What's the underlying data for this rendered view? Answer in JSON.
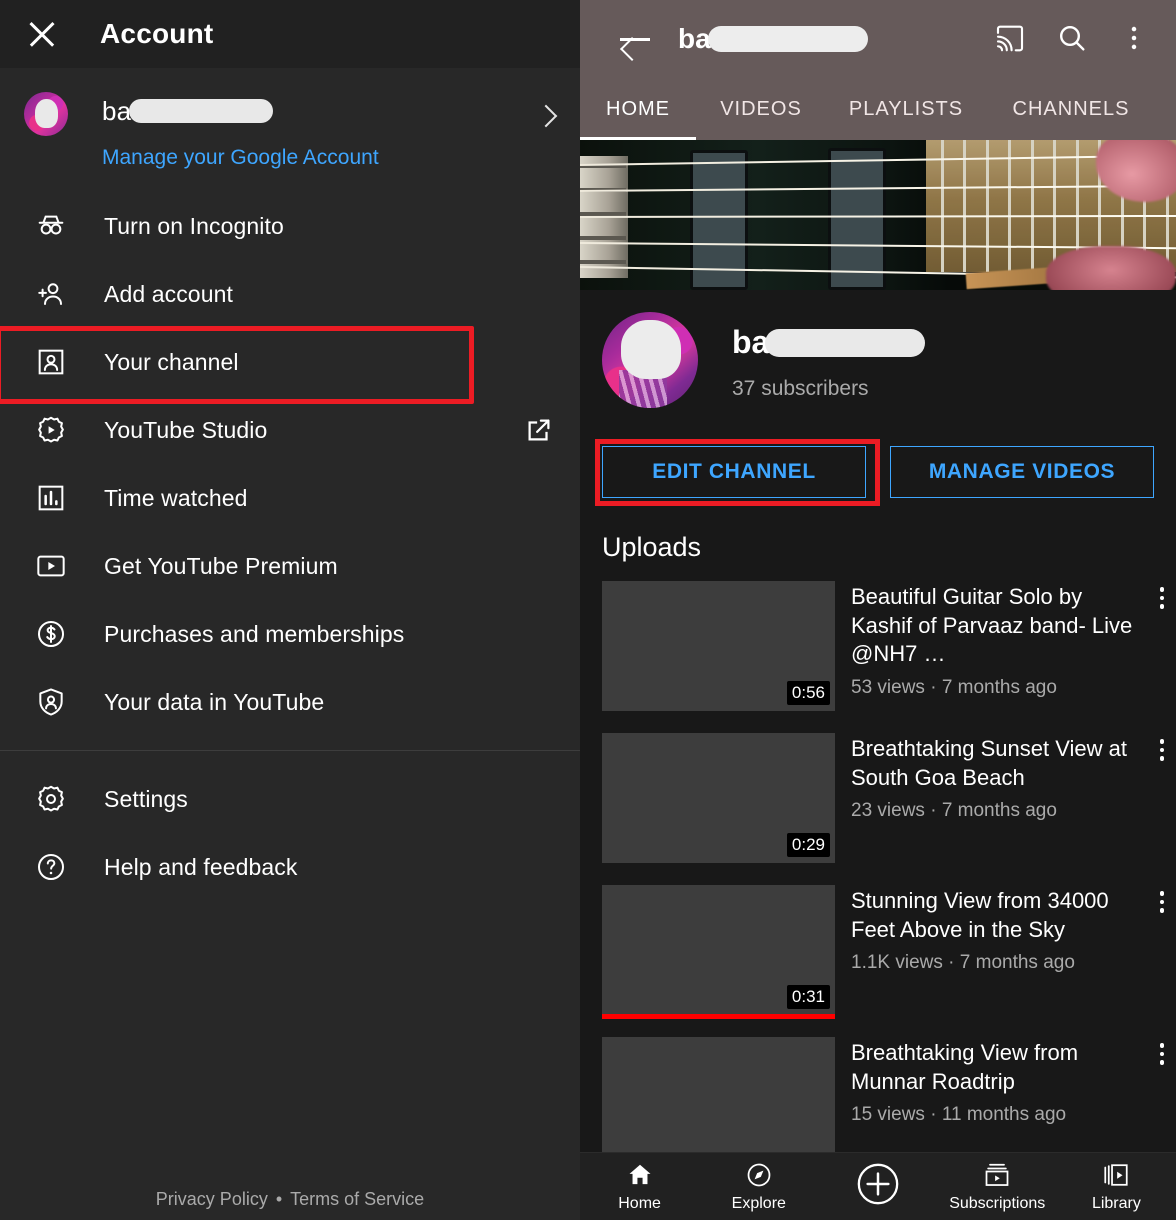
{
  "left_panel": {
    "header": {
      "title": "Account",
      "close_icon": "close-icon"
    },
    "account": {
      "name_prefix": "ba",
      "name_redacted": true,
      "manage_link": "Manage your Google Account",
      "chevron_icon": "chevron-right-icon",
      "avatar_icon": "avatar"
    },
    "menu_group_1": [
      {
        "label": "Turn on Incognito",
        "icon": "incognito-icon"
      },
      {
        "label": "Add account",
        "icon": "person-add-icon"
      },
      {
        "label": "Your channel",
        "icon": "person-box-icon",
        "highlighted": true
      },
      {
        "label": "YouTube Studio",
        "icon": "studio-gear-icon",
        "trailing_icon": "open-in-new-icon"
      },
      {
        "label": "Time watched",
        "icon": "bar-chart-icon"
      },
      {
        "label": "Get YouTube Premium",
        "icon": "youtube-play-icon"
      },
      {
        "label": "Purchases and memberships",
        "icon": "dollar-circle-icon"
      },
      {
        "label": "Your data in YouTube",
        "icon": "shield-person-icon"
      }
    ],
    "menu_group_2": [
      {
        "label": "Settings",
        "icon": "gear-icon"
      },
      {
        "label": "Help and feedback",
        "icon": "help-circle-icon"
      }
    ],
    "footer": {
      "privacy": "Privacy Policy",
      "separator": "•",
      "terms": "Terms of Service"
    }
  },
  "right_panel": {
    "header": {
      "back_icon": "back-arrow-icon",
      "title_prefix": "ba",
      "title_redacted": true,
      "actions": [
        {
          "icon": "cast-icon"
        },
        {
          "icon": "search-icon"
        },
        {
          "icon": "more-vert-icon"
        }
      ]
    },
    "tabs": [
      {
        "label": "HOME",
        "active": true
      },
      {
        "label": "VIDEOS",
        "active": false
      },
      {
        "label": "PLAYLISTS",
        "active": false
      },
      {
        "label": "CHANNELS",
        "active": false
      }
    ],
    "banner": {
      "icon": "channel-banner-bass-guitar"
    },
    "channel": {
      "avatar_icon": "channel-avatar",
      "name_prefix": "ba",
      "name_redacted": true,
      "subscribers": "37 subscribers"
    },
    "buttons": [
      {
        "label": "EDIT CHANNEL",
        "highlighted": true
      },
      {
        "label": "MANAGE VIDEOS",
        "highlighted": false
      }
    ],
    "uploads": {
      "section_title": "Uploads",
      "videos": [
        {
          "title": "Beautiful Guitar Solo by Kashif of Parvaaz band- Live @NH7 …",
          "views": "53 views",
          "separator": "·",
          "age": "7 months ago",
          "duration": "0:56",
          "progress": false
        },
        {
          "title": "Breathtaking Sunset View at South Goa Beach",
          "views": "23 views",
          "separator": "·",
          "age": "7 months ago",
          "duration": "0:29",
          "progress": false
        },
        {
          "title": "Stunning View from 34000 Feet Above in the Sky",
          "views": "1.1K views",
          "separator": "·",
          "age": "7 months ago",
          "duration": "0:31",
          "progress": true
        },
        {
          "title": "Breathtaking View from Munnar Roadtrip",
          "views": "15 views",
          "separator": "·",
          "age": "11 months ago",
          "duration": "",
          "progress": false
        }
      ]
    },
    "bottom_nav": [
      {
        "label": "Home",
        "icon": "home-icon",
        "active": true
      },
      {
        "label": "Explore",
        "icon": "compass-icon",
        "active": false
      },
      {
        "label": "",
        "icon": "plus-circle-icon",
        "active": false
      },
      {
        "label": "Subscriptions",
        "icon": "subscriptions-icon",
        "active": false
      },
      {
        "label": "Library",
        "icon": "library-icon",
        "active": false
      }
    ]
  },
  "colors": {
    "accent_blue": "#3ea6ff",
    "highlight_red": "#ec1c24",
    "progress_red": "#ff0000",
    "left_bg": "#282828",
    "left_header_bg": "#212121",
    "right_bg": "#181818",
    "channel_header_bg": "#665a5a",
    "thumb_placeholder": "#3d3d3d",
    "secondary_text": "#aaaaaa"
  }
}
